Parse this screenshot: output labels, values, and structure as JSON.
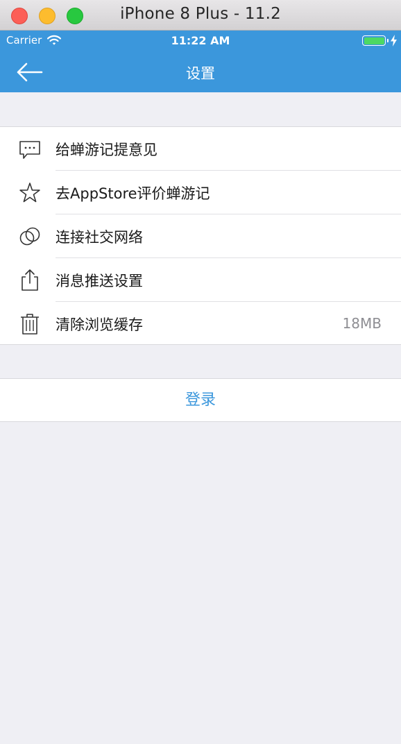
{
  "window": {
    "title": "iPhone 8 Plus - 11.2"
  },
  "status_bar": {
    "carrier": "Carrier",
    "time": "11:22 AM",
    "battery_level": 1.0
  },
  "nav": {
    "title": "设置",
    "back_icon": "arrow-left-icon"
  },
  "settings": {
    "items": [
      {
        "label": "给蝉游记提意见",
        "icon": "message-icon"
      },
      {
        "label": "去AppStore评价蝉游记",
        "icon": "star-icon"
      },
      {
        "label": "连接社交网络",
        "icon": "link-icon"
      },
      {
        "label": "消息推送设置",
        "icon": "share-icon"
      },
      {
        "label": "清除浏览缓存",
        "icon": "trash-icon",
        "value": "18MB"
      }
    ]
  },
  "login": {
    "label": "登录"
  },
  "colors": {
    "accent": "#3b97dc",
    "background": "#efeff4",
    "battery": "#4cd964"
  }
}
